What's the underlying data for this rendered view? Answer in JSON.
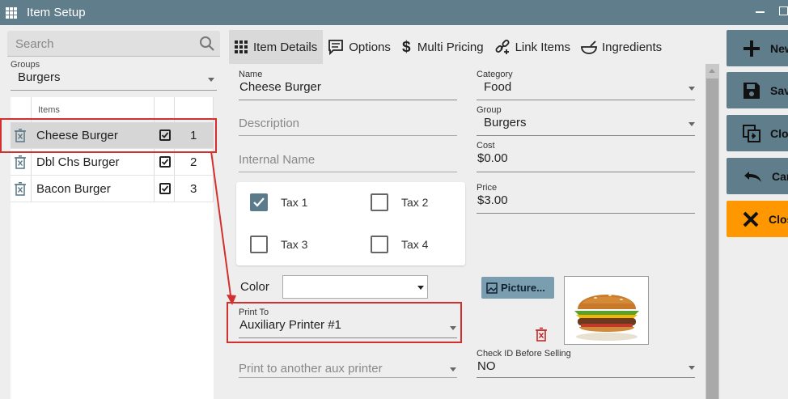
{
  "window": {
    "title": "Item Setup"
  },
  "search": {
    "placeholder": "Search"
  },
  "groups": {
    "label": "Groups",
    "value": "Burgers"
  },
  "items_table": {
    "header": "Items",
    "rows": [
      {
        "name": "Cheese Burger",
        "checked": true,
        "order": "1",
        "selected": true
      },
      {
        "name": "Dbl Chs Burger",
        "checked": true,
        "order": "2",
        "selected": false
      },
      {
        "name": "Bacon Burger",
        "checked": true,
        "order": "3",
        "selected": false
      }
    ]
  },
  "tabs": [
    {
      "label": "Item Details",
      "icon": "grid-icon",
      "active": true
    },
    {
      "label": "Options",
      "icon": "chat-icon",
      "active": false
    },
    {
      "label": "Multi Pricing",
      "icon": "dollar-icon",
      "active": false
    },
    {
      "label": "Link Items",
      "icon": "link-add-icon",
      "active": false
    },
    {
      "label": "Ingredients",
      "icon": "bowl-icon",
      "active": false
    }
  ],
  "details": {
    "name": {
      "label": "Name",
      "value": "Cheese Burger"
    },
    "description": {
      "placeholder": "Description"
    },
    "internal_name": {
      "placeholder": "Internal Name"
    },
    "category": {
      "label": "Category",
      "value": "Food"
    },
    "group": {
      "label": "Group",
      "value": "Burgers"
    },
    "cost": {
      "label": "Cost",
      "value": "$0.00"
    },
    "price": {
      "label": "Price",
      "value": "$3.00"
    },
    "taxes": [
      {
        "label": "Tax 1",
        "checked": true
      },
      {
        "label": "Tax 2",
        "checked": false
      },
      {
        "label": "Tax 3",
        "checked": false
      },
      {
        "label": "Tax 4",
        "checked": false
      }
    ],
    "color": {
      "label": "Color",
      "value": ""
    },
    "print_to": {
      "label": "Print To",
      "value": "Auxiliary Printer #1"
    },
    "print_to_aux": {
      "placeholder": "Print to another aux printer"
    },
    "check_id": {
      "label": "Check ID Before Selling",
      "value": "NO"
    },
    "picture_button": "Picture..."
  },
  "actions": [
    {
      "label": "New",
      "icon": "plus-icon"
    },
    {
      "label": "Save",
      "icon": "floppy-icon"
    },
    {
      "label": "Clone",
      "icon": "clone-icon"
    },
    {
      "label": "Cancel",
      "icon": "undo-icon"
    },
    {
      "label": "Close",
      "icon": "close-icon"
    }
  ],
  "colors": {
    "titlebar": "#607d8b",
    "action_button": "#607d8b",
    "close_button": "#ff9800",
    "highlight": "#d32f2f",
    "checked_tax": "#5b7b8c"
  }
}
